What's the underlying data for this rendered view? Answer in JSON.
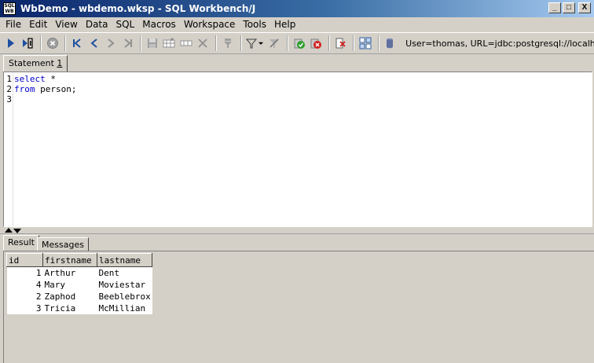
{
  "window": {
    "title": "WbDemo - wbdemo.wksp  - SQL Workbench/J",
    "icon_text_top": "SQL",
    "icon_text_bottom": "WB",
    "minimize_label": "_",
    "maximize_label": "□",
    "close_label": "X"
  },
  "menu": [
    "File",
    "Edit",
    "View",
    "Data",
    "SQL",
    "Macros",
    "Workspace",
    "Tools",
    "Help"
  ],
  "toolbar": {
    "connection_info": "User=thomas, URL=jdbc:postgresql://localhost/w"
  },
  "statement_tab": {
    "label": "Statement ",
    "number": "1"
  },
  "editor": {
    "line_numbers": [
      "1",
      "2",
      "3"
    ],
    "lines": [
      {
        "keyword": "select",
        "rest": " *"
      },
      {
        "keyword": "from",
        "rest": " person;"
      },
      {
        "keyword": "",
        "rest": ""
      }
    ]
  },
  "result_tabs": [
    "Result",
    "Messages"
  ],
  "result_grid": {
    "columns": [
      "id",
      "firstname",
      "lastname"
    ],
    "rows": [
      [
        "1",
        "Arthur",
        "Dent"
      ],
      [
        "4",
        "Mary",
        "Moviestar"
      ],
      [
        "2",
        "Zaphod",
        "Beeblebrox"
      ],
      [
        "3",
        "Tricia",
        "McMillian"
      ]
    ]
  },
  "colors": {
    "title_gradient_start": "#0a246a",
    "title_gradient_end": "#a6caf0",
    "keyword": "#0000cc",
    "chrome": "#d4d0c8"
  },
  "icons": [
    "execute-icon",
    "execute-current-icon",
    "stop-icon",
    "first-icon",
    "previous-icon",
    "next-icon",
    "last-icon",
    "save-icon",
    "insert-row-icon",
    "copy-row-icon",
    "delete-row-icon",
    "filter-icon",
    "filter-dropdown-icon",
    "reset-filter-icon",
    "commit-icon",
    "rollback-icon",
    "disconnect-icon",
    "db-explorer-icon",
    "connection-icon"
  ]
}
